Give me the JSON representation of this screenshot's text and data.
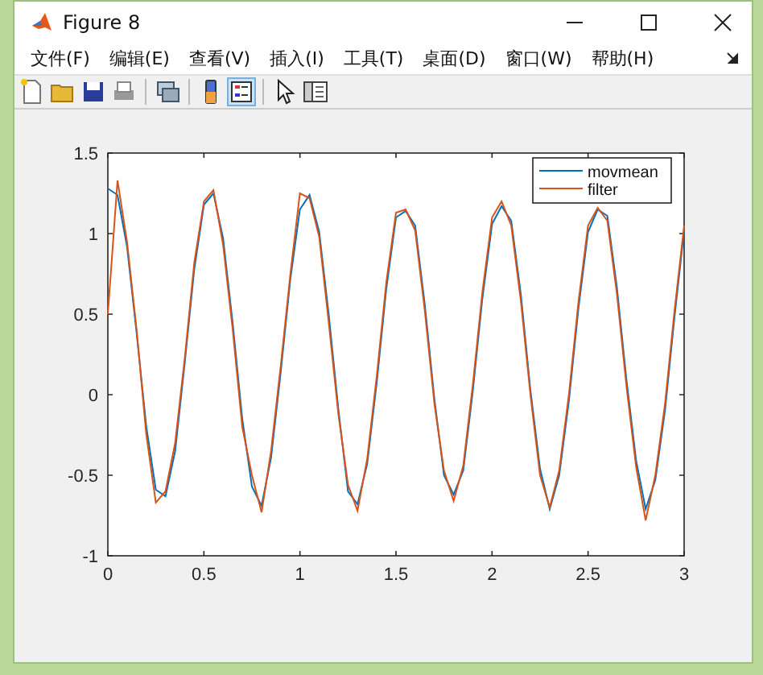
{
  "window": {
    "title": "Figure 8"
  },
  "menu": [
    "文件(F)",
    "编辑(E)",
    "查看(V)",
    "插入(I)",
    "工具(T)",
    "桌面(D)",
    "窗口(W)",
    "帮助(H)"
  ],
  "toolbar": [
    {
      "kind": "new",
      "pressed": false
    },
    {
      "kind": "open",
      "pressed": false
    },
    {
      "kind": "save",
      "pressed": false
    },
    {
      "kind": "print",
      "pressed": false
    },
    {
      "kind": "sep"
    },
    {
      "kind": "link",
      "pressed": false
    },
    {
      "kind": "sep"
    },
    {
      "kind": "colorbar",
      "pressed": false
    },
    {
      "kind": "legend",
      "pressed": true
    },
    {
      "kind": "sep"
    },
    {
      "kind": "pointer",
      "pressed": false
    },
    {
      "kind": "property",
      "pressed": false
    }
  ],
  "axes": {
    "chart_data": {
      "type": "line",
      "x": [
        0,
        0.05,
        0.1,
        0.15,
        0.2,
        0.25,
        0.3,
        0.35,
        0.4,
        0.45,
        0.5,
        0.55,
        0.6,
        0.65,
        0.7,
        0.75,
        0.8,
        0.85,
        0.9,
        0.95,
        1,
        1.05,
        1.1,
        1.15,
        1.2,
        1.25,
        1.3,
        1.35,
        1.4,
        1.45,
        1.5,
        1.55,
        1.6,
        1.65,
        1.7,
        1.75,
        1.8,
        1.85,
        1.9,
        1.95,
        2,
        2.05,
        2.1,
        2.15,
        2.2,
        2.25,
        2.3,
        2.35,
        2.4,
        2.45,
        2.5,
        2.55,
        2.6,
        2.65,
        2.7,
        2.75,
        2.8,
        2.85,
        2.9,
        2.95,
        3
      ],
      "series": [
        {
          "name": "movmean",
          "color": "#0072bd",
          "values": [
            1.28,
            1.24,
            0.92,
            0.38,
            -0.2,
            -0.59,
            -0.63,
            -0.35,
            0.19,
            0.78,
            1.18,
            1.25,
            0.97,
            0.44,
            -0.15,
            -0.57,
            -0.69,
            -0.39,
            0.14,
            0.72,
            1.15,
            1.24,
            1.01,
            0.5,
            -0.09,
            -0.6,
            -0.68,
            -0.43,
            0.08,
            0.66,
            1.1,
            1.14,
            1.05,
            0.56,
            -0.03,
            -0.5,
            -0.62,
            -0.47,
            0.02,
            0.6,
            1.06,
            1.17,
            1.08,
            0.62,
            0.03,
            -0.46,
            -0.71,
            -0.5,
            -0.04,
            0.54,
            1.01,
            1.15,
            1.11,
            0.67,
            0.09,
            -0.41,
            -0.71,
            -0.53,
            -0.1,
            0.48,
            1.02
          ]
        },
        {
          "name": "filter",
          "color": "#d95319",
          "values": [
            0.5,
            1.33,
            0.95,
            0.4,
            -0.25,
            -0.67,
            -0.6,
            -0.3,
            0.22,
            0.82,
            1.2,
            1.27,
            0.93,
            0.4,
            -0.2,
            -0.5,
            -0.73,
            -0.35,
            0.18,
            0.75,
            1.25,
            1.22,
            0.98,
            0.45,
            -0.12,
            -0.56,
            -0.72,
            -0.4,
            0.12,
            0.7,
            1.13,
            1.15,
            1.02,
            0.52,
            -0.06,
            -0.47,
            -0.66,
            -0.44,
            0.06,
            0.64,
            1.1,
            1.2,
            1.05,
            0.58,
            0,
            -0.5,
            -0.7,
            -0.47,
            0,
            0.58,
            1.05,
            1.16,
            1.08,
            0.63,
            0.05,
            -0.45,
            -0.78,
            -0.5,
            -0.06,
            0.52,
            1.05
          ]
        }
      ],
      "legend": true,
      "xlim": [
        0,
        3
      ],
      "ylim": [
        -1,
        1.5
      ],
      "xticks": [
        0,
        0.5,
        1,
        1.5,
        2,
        2.5,
        3
      ],
      "yticks": [
        -1,
        -0.5,
        0,
        0.5,
        1,
        1.5
      ]
    }
  }
}
